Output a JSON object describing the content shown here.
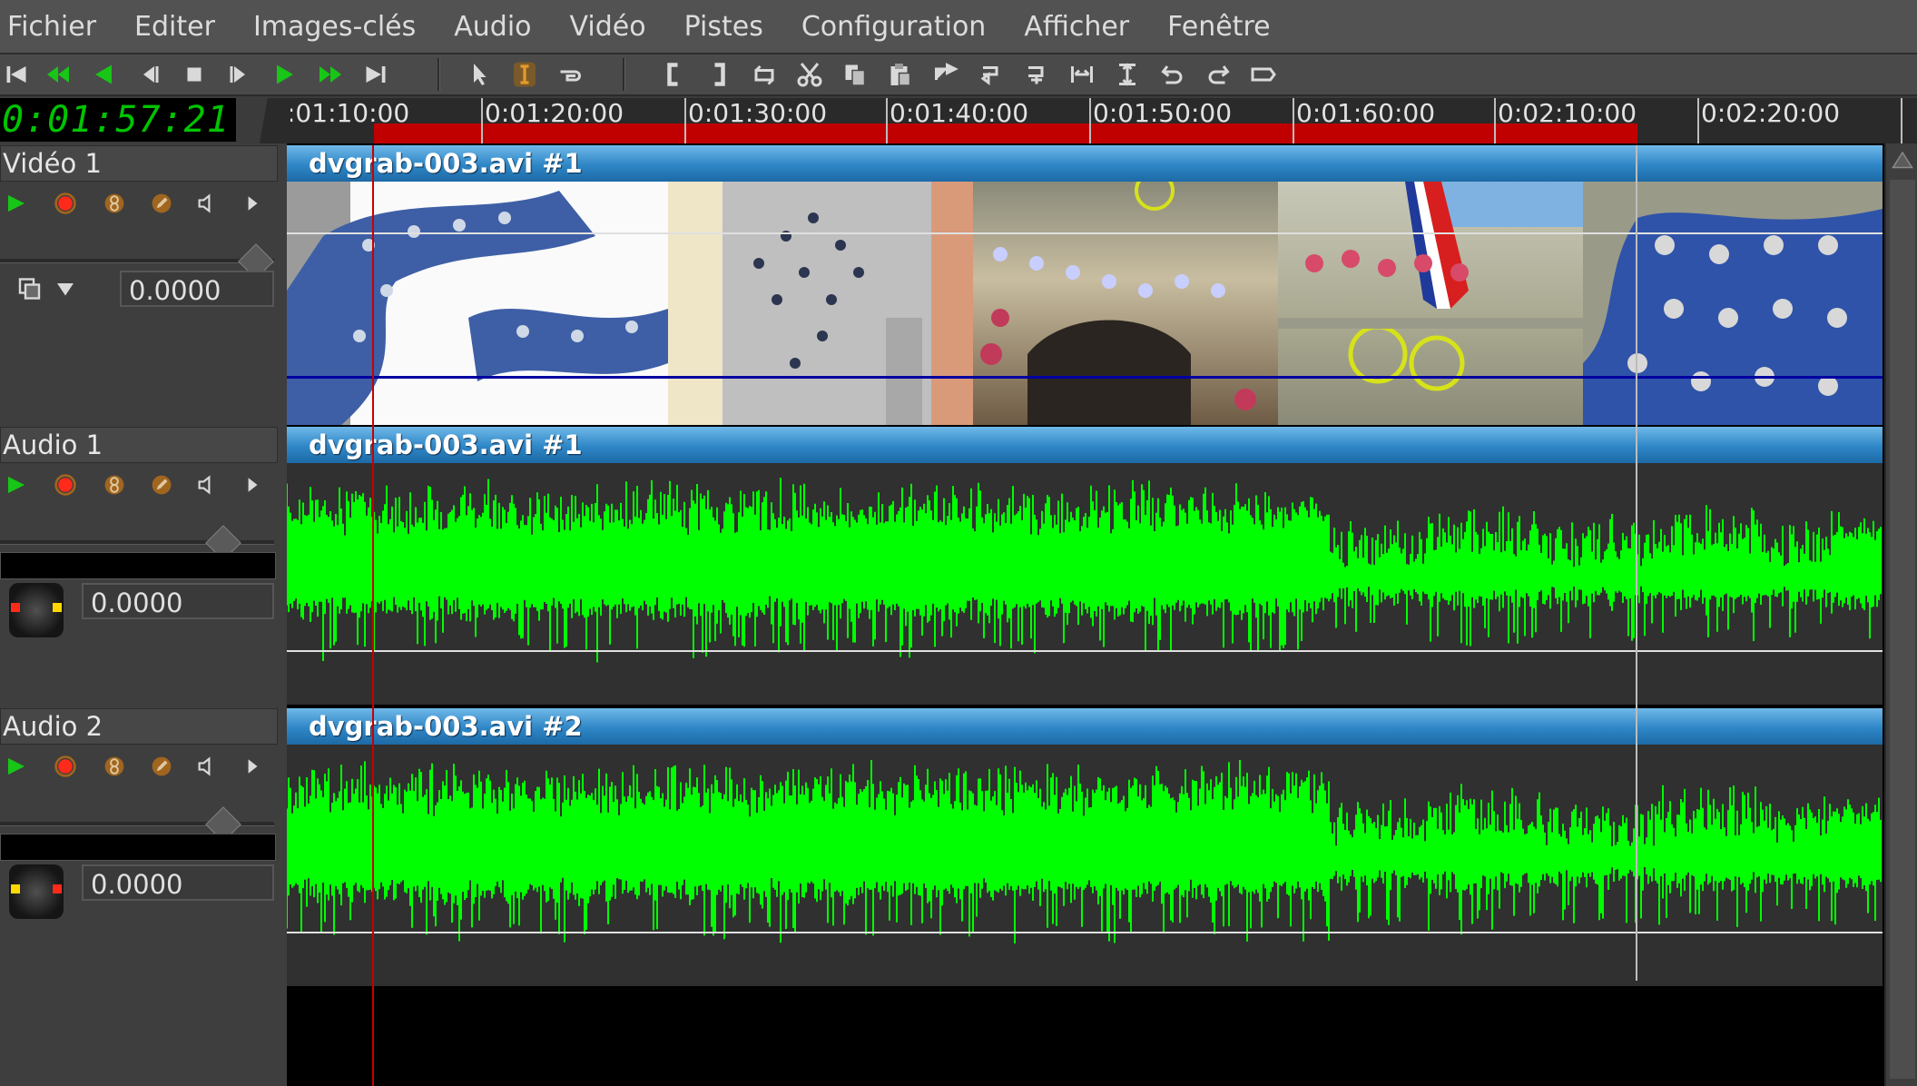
{
  "menu": [
    "Fichier",
    "Editer",
    "Images-clés",
    "Audio",
    "Vidéo",
    "Pistes",
    "Configuration",
    "Afficher",
    "Fenêtre"
  ],
  "toolbar": {
    "transport": [
      "rewind-to-start-icon",
      "fast-rewind-icon",
      "play-reverse-icon",
      "frame-back-icon",
      "stop-icon",
      "frame-forward-icon",
      "play-icon",
      "fast-forward-icon",
      "jump-to-end-icon"
    ],
    "edit_tools": [
      "arrow-select-icon",
      "ibeam-select-icon",
      "hand-tool-icon",
      "in-point-icon",
      "out-point-icon",
      "loop-icon",
      "scissors-icon",
      "copy-icon",
      "paste-icon",
      "splice-icon",
      "overwrite-icon",
      "lift-icon",
      "extract-icon",
      "fit-icon",
      "undo-icon",
      "redo-icon",
      "toggle-label-icon"
    ],
    "colors": {
      "transport": "#17c617",
      "tool_highlight": "#e39a2a",
      "tool": "#d9d9d9"
    }
  },
  "timecode": "0:01:57:21",
  "ruler": {
    "labels": [
      ":01:10:00",
      "0:01:20:00",
      "0:01:30:00",
      "0:01:40:00",
      "0:01:50:00",
      "0:01:60:00",
      "0:02:10:00",
      "0:02:20:00"
    ],
    "range_color": "#c00000"
  },
  "tracks": [
    {
      "name": "Vidéo 1",
      "value": "0.0000",
      "clip": "dvgrab-003.avi #1",
      "kind": "video"
    },
    {
      "name": "Audio 1",
      "value": "0.0000",
      "clip": "dvgrab-003.avi #1",
      "kind": "audio"
    },
    {
      "name": "Audio 2",
      "value": "0.0000",
      "clip": "dvgrab-003.avi #2",
      "kind": "audio"
    }
  ],
  "track_buttons": [
    "play-track-icon",
    "record-track-icon",
    "gang-icon",
    "draw-icon",
    "mute-speaker-icon",
    "expand-arrow-icon"
  ],
  "colors": {
    "waveform": "#00ff00",
    "clip_bar": "#2e86c6",
    "playhead": "#c80000"
  }
}
